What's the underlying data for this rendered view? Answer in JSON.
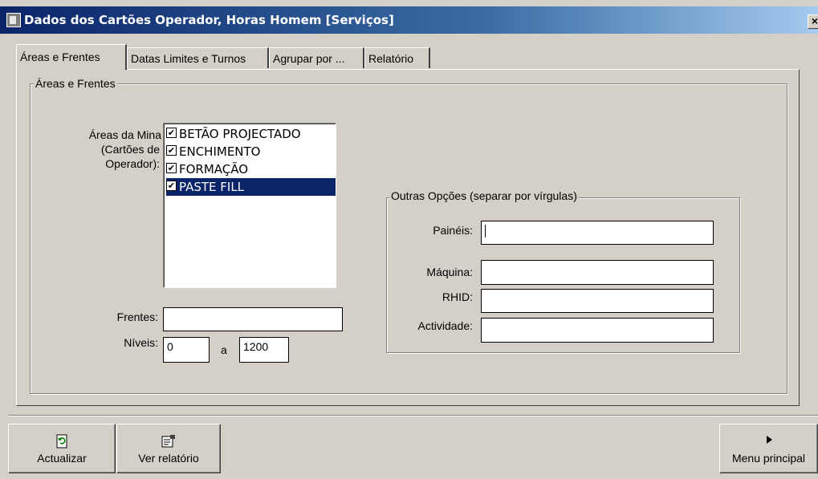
{
  "window": {
    "title": "Dados dos Cartões Operador, Horas Homem [Serviços]",
    "close_label": "×"
  },
  "tabs": [
    {
      "label": "Áreas e Frentes",
      "active": true
    },
    {
      "label": "Datas Limites e Turnos",
      "active": false
    },
    {
      "label": "Agrupar por ...",
      "active": false
    },
    {
      "label": "Relatório",
      "active": false
    }
  ],
  "areas_group": {
    "legend": "Áreas e Frentes",
    "areas_label_1": "Áreas da Mina",
    "areas_label_2": "(Cartões de",
    "areas_label_3": "Operador):",
    "areas_list": [
      {
        "label": "BETÃO PROJECTADO",
        "checked": true,
        "selected": false
      },
      {
        "label": "ENCHIMENTO",
        "checked": true,
        "selected": false
      },
      {
        "label": "FORMAÇÃO",
        "checked": true,
        "selected": false
      },
      {
        "label": "PASTE FILL",
        "checked": true,
        "selected": true
      }
    ],
    "frentes_label": "Frentes:",
    "frentes_value": "",
    "niveis_label": "Níveis:",
    "niveis_from": "0",
    "niveis_sep": "a",
    "niveis_to": "1200"
  },
  "other_options": {
    "legend": "Outras Opções (separar por vírgulas)",
    "paineis_label": "Painéis:",
    "paineis_value": "",
    "maquina_label": "Máquina:",
    "maquina_value": "",
    "rhid_label": "RHID:",
    "rhid_value": "",
    "actividade_label": "Actividade:",
    "actividade_value": ""
  },
  "buttons": {
    "actualizar": "Actualizar",
    "ver_relatorio": "Ver relatório",
    "menu_principal": "Menu principal"
  },
  "icons": {
    "title": "window-icon",
    "actualizar": "refresh-icon",
    "ver_relatorio": "report-icon",
    "menu_principal": "play-arrow-icon"
  },
  "colors": {
    "titlebar": "#0a246a",
    "face": "#d4d0c8",
    "selection": "#0a246a"
  }
}
